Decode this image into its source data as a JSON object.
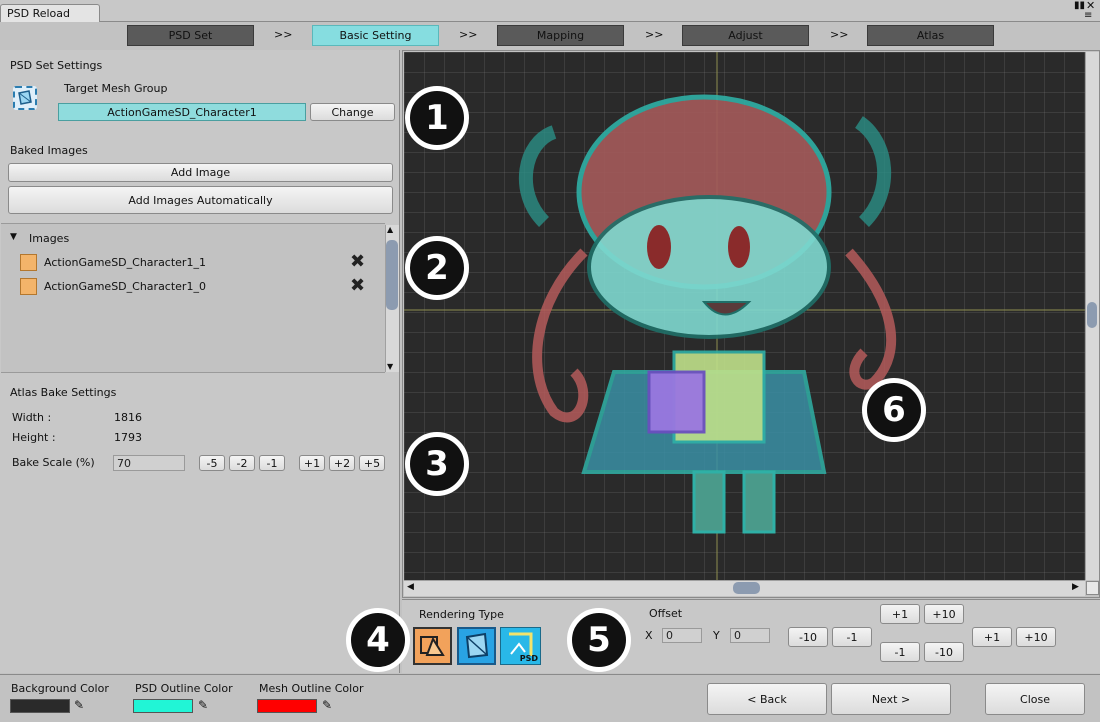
{
  "window": {
    "tab_title": "PSD Reload"
  },
  "steps": [
    {
      "label": "PSD Set",
      "active": false
    },
    {
      "label": "Basic Setting",
      "active": true
    },
    {
      "label": "Mapping",
      "active": false
    },
    {
      "label": "Adjust",
      "active": false
    },
    {
      "label": "Atlas",
      "active": false
    }
  ],
  "step_separator": ">>",
  "psd_set": {
    "section_title": "PSD Set Settings",
    "target_label": "Target Mesh Group",
    "target_value": "ActionGameSD_Character1",
    "change_label": "Change"
  },
  "baked": {
    "section_title": "Baked Images",
    "add_image_label": "Add Image",
    "add_auto_label": "Add Images Automatically"
  },
  "images_list": {
    "header": "Images",
    "items": [
      "ActionGameSD_Character1_1",
      "ActionGameSD_Character1_0"
    ]
  },
  "atlas": {
    "section_title": "Atlas Bake Settings",
    "width_label": "Width :",
    "width_value": "1816",
    "height_label": "Height :",
    "height_value": "1793",
    "scale_label": "Bake Scale (%)",
    "scale_value": "70",
    "scale_buttons": [
      "-5",
      "-2",
      "-1",
      "+1",
      "+2",
      "+5"
    ]
  },
  "rendering": {
    "title": "Rendering Type",
    "psd_tag": "PSD"
  },
  "offset": {
    "title": "Offset",
    "x_label": "X",
    "x_value": "0",
    "y_label": "Y",
    "y_value": "0",
    "x_minus10": "-10",
    "x_minus1": "-1",
    "y_plus1": "+1",
    "y_plus10": "+10",
    "y_minus1": "-1",
    "y_minus10": "-10",
    "x_plus1": "+1",
    "x_plus10": "+10"
  },
  "badges": [
    "1",
    "2",
    "3",
    "4",
    "5",
    "6"
  ],
  "footer": {
    "bg_color_label": "Background Color",
    "psd_outline_label": "PSD Outline Color",
    "mesh_outline_label": "Mesh Outline Color",
    "back_label": "< Back",
    "next_label": "Next >",
    "close_label": "Close"
  },
  "colors": {
    "background": "#2a2a2a",
    "psd_outline": "#21f5d6",
    "mesh_outline": "#ff0000",
    "accent": "#86dde0"
  }
}
